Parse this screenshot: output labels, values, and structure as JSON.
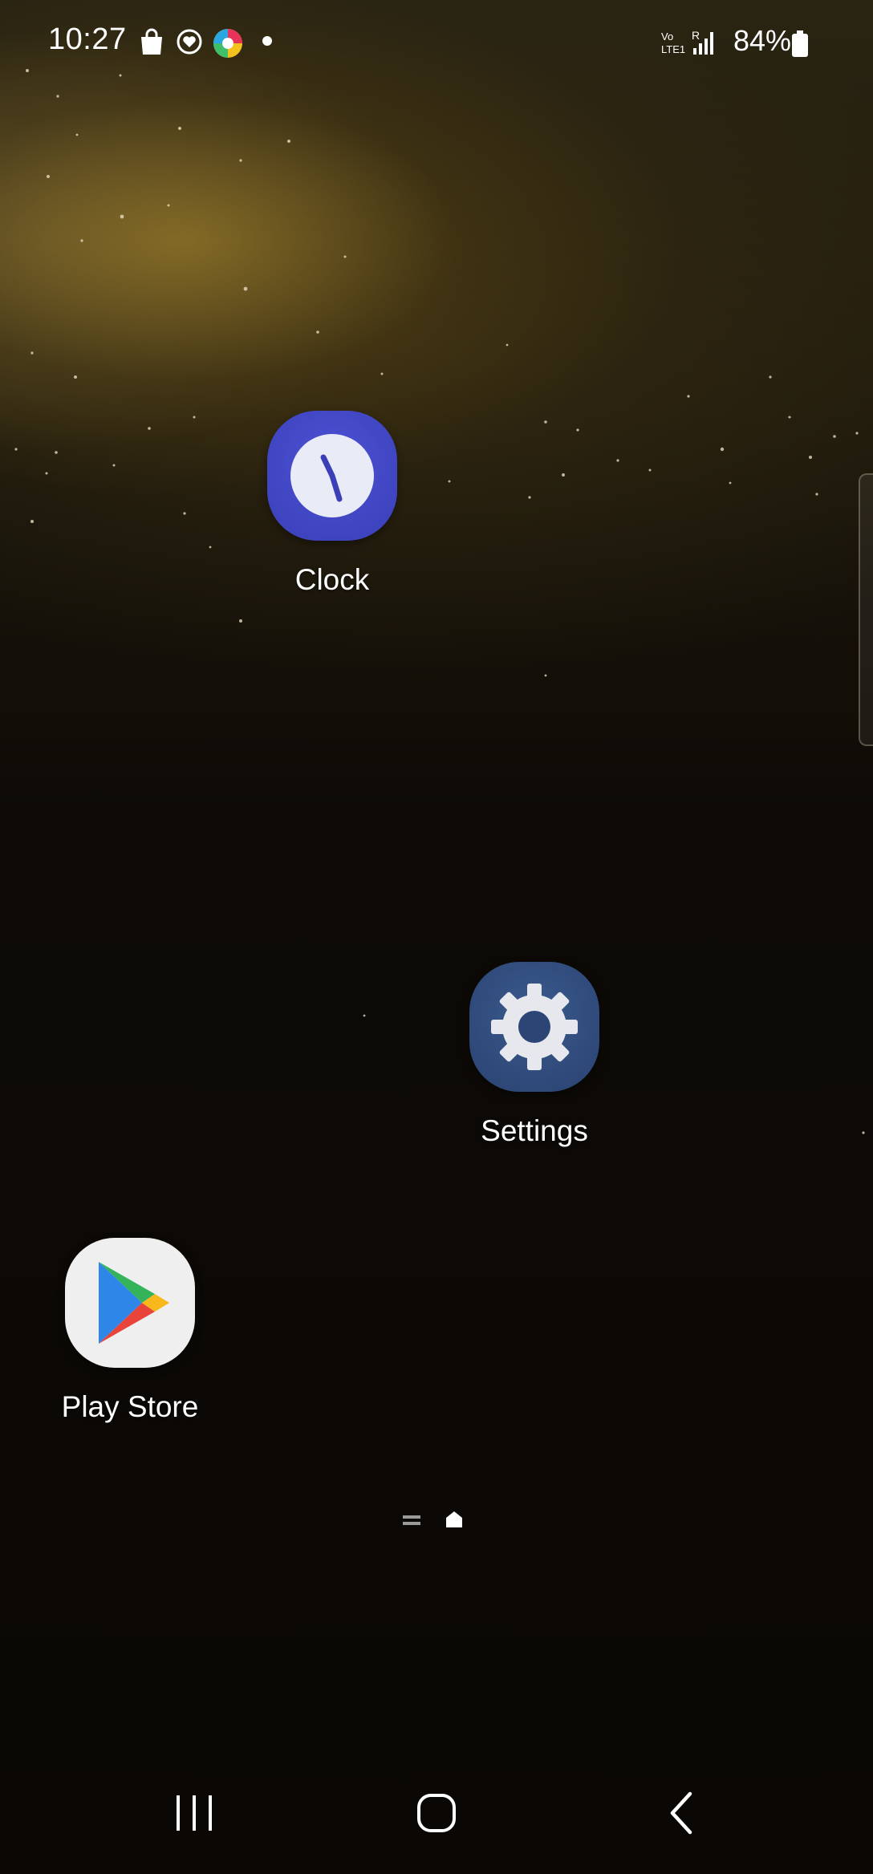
{
  "status_bar": {
    "time": "10:27",
    "battery": "84%",
    "network": "VoLTE",
    "notification_icons": [
      "shopping-bag-icon",
      "heart-app-icon",
      "colorful-app-icon",
      "dot-icon"
    ]
  },
  "apps": {
    "clock": {
      "label": "Clock",
      "icon_color": "#3f45c2"
    },
    "settings": {
      "label": "Settings",
      "icon_color": "#2f4a7a"
    },
    "play_store": {
      "label": "Play Store",
      "icon_color": "#f0f0f0"
    }
  },
  "page_indicator": {
    "items": [
      "menu-lines-icon",
      "home-icon"
    ],
    "active": "home-icon"
  },
  "nav_bar": {
    "buttons": [
      "recents-button",
      "home-button",
      "back-button"
    ]
  }
}
